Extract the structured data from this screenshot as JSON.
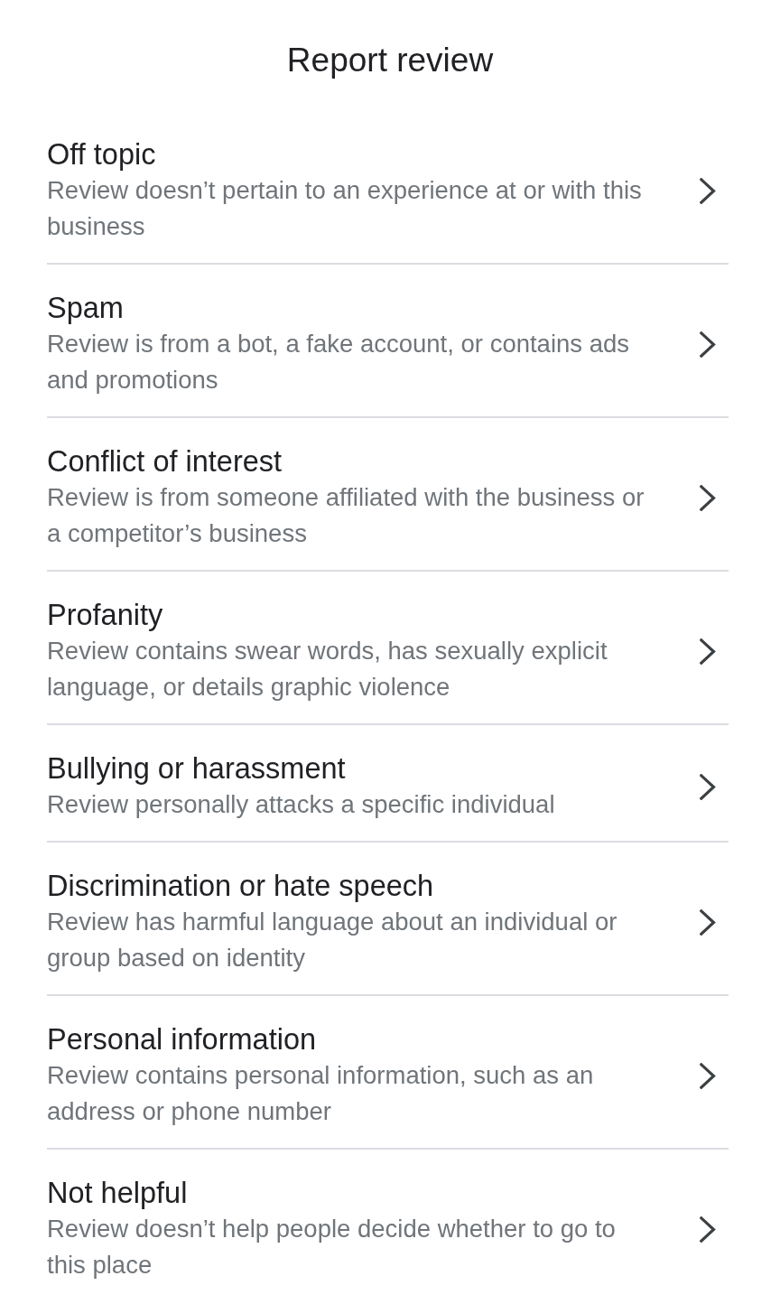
{
  "header": {
    "title": "Report review"
  },
  "options": [
    {
      "title": "Off topic",
      "description": "Review doesn’t pertain to an experience at or with this business"
    },
    {
      "title": "Spam",
      "description": "Review is from a bot, a fake account, or contains ads and promotions"
    },
    {
      "title": "Conflict of interest",
      "description": "Review is from someone affiliated with the business or a competitor’s business"
    },
    {
      "title": "Profanity",
      "description": "Review contains swear words, has sexually explicit language, or details graphic violence"
    },
    {
      "title": "Bullying or harassment",
      "description": "Review personally attacks a specific individual"
    },
    {
      "title": "Discrimination or hate speech",
      "description": "Review has harmful language about an individual or group based on identity"
    },
    {
      "title": "Personal information",
      "description": "Review contains personal information, such as an address or phone number"
    },
    {
      "title": "Not helpful",
      "description": "Review doesn’t help people decide whether to go to this place"
    }
  ]
}
